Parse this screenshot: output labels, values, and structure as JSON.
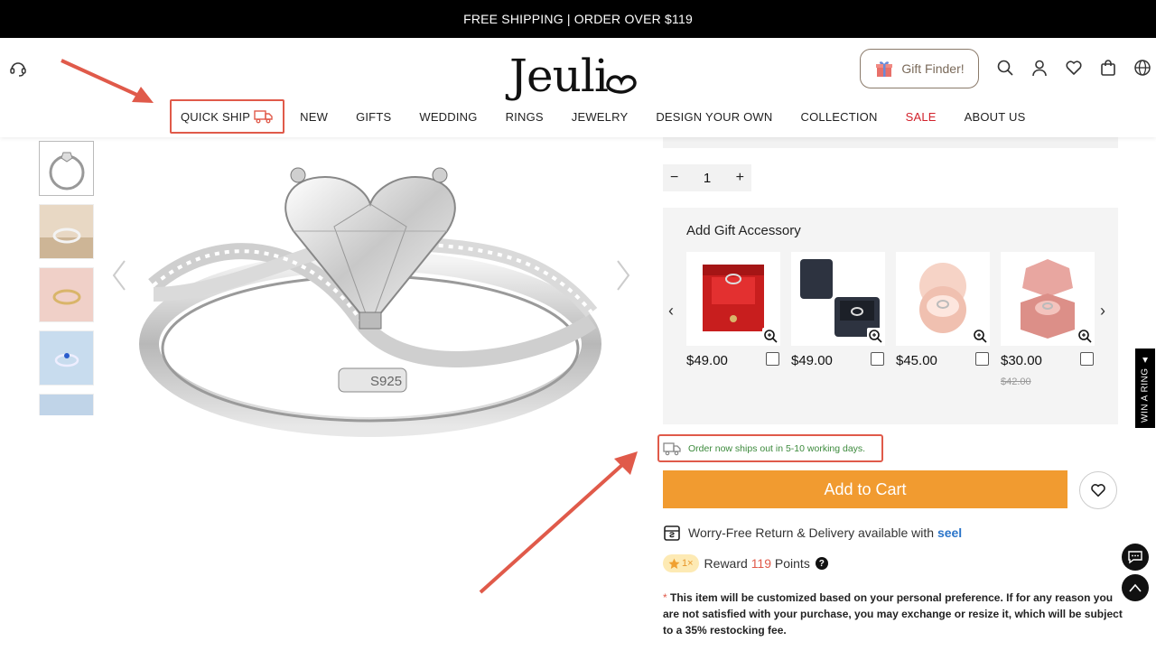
{
  "topbar": {
    "text": "FREE SHIPPING | ORDER OVER $119"
  },
  "header": {
    "logo": "Jeuli",
    "gift_finder": "Gift Finder!",
    "icons": [
      "search-icon",
      "user-icon",
      "heart-icon",
      "bag-icon",
      "globe-icon"
    ]
  },
  "nav": {
    "quick_ship": "QUICK SHIP",
    "items": [
      "NEW",
      "GIFTS",
      "WEDDING",
      "RINGS",
      "JEWELRY",
      "DESIGN YOUR OWN",
      "COLLECTION",
      "SALE",
      "ABOUT US"
    ]
  },
  "product": {
    "engraving": "S925",
    "quantity": "1"
  },
  "gift": {
    "title": "Add Gift Accessory",
    "items": [
      {
        "price": "$49.00",
        "old": ""
      },
      {
        "price": "$49.00",
        "old": ""
      },
      {
        "price": "$45.00",
        "old": ""
      },
      {
        "price": "$30.00",
        "old": "$42.00"
      }
    ]
  },
  "shipping": {
    "note": "Order now ships out in 5-10 working days."
  },
  "cart": {
    "label": "Add to Cart"
  },
  "worry": {
    "text": "Worry-Free Return & Delivery available with ",
    "brand": "seel"
  },
  "reward": {
    "multiplier": "1×",
    "prefix": "Reward ",
    "points": "119",
    "suffix": " Points"
  },
  "note": {
    "star": "* ",
    "text": "This item will be customized based on your personal preference. If for any reason you are not satisfied with your purchase, you may exchange or resize it, which will be subject to a 35% restocking fee."
  },
  "side": {
    "win_ring": "WIN A RING ▲"
  },
  "colors": {
    "accent": "#f19b30",
    "annotation": "#e05a4a",
    "sale": "#d2222c",
    "ship_text": "#3c8a3c",
    "seel": "#2a74c9"
  }
}
